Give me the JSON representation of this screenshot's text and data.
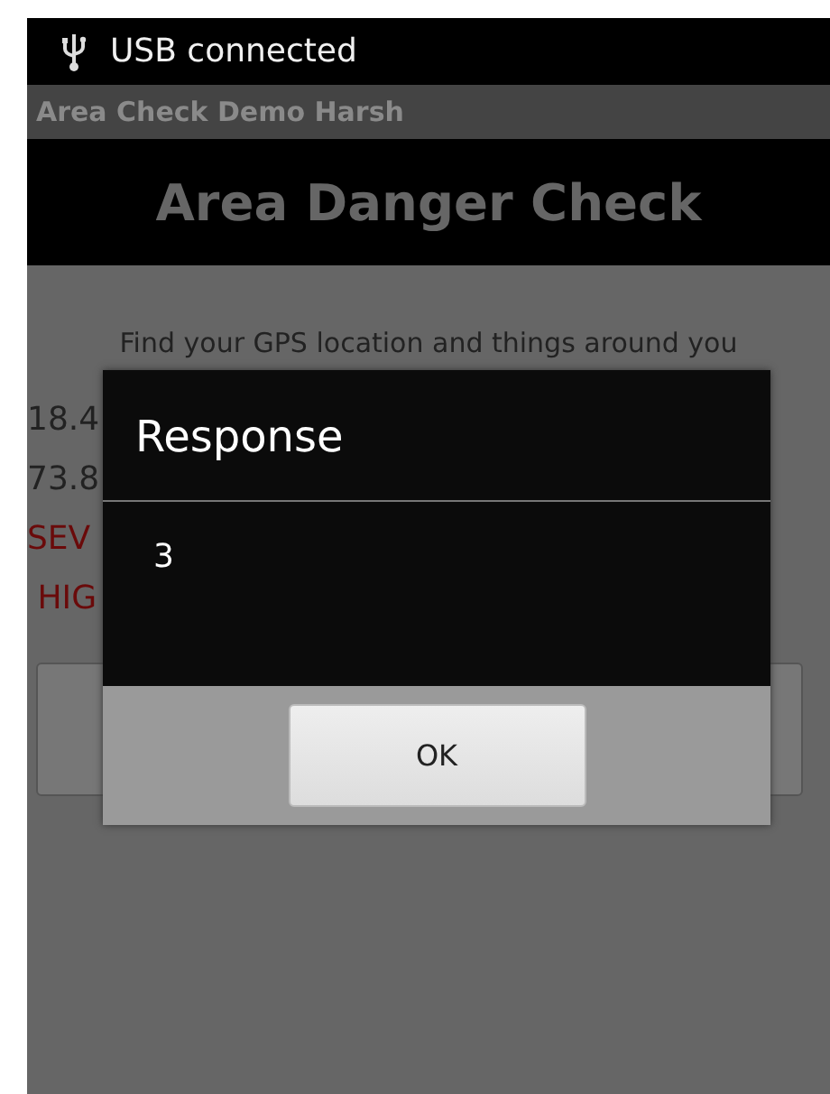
{
  "status_bar": {
    "text": "USB connected"
  },
  "app_bar": {
    "title": "Area Check Demo Harsh"
  },
  "header": {
    "title": "Area Danger Check"
  },
  "instruction": "Find your GPS location and things around you",
  "readings": [
    {
      "text": "18.4",
      "kind": "plain"
    },
    {
      "text": "73.8",
      "kind": "plain"
    },
    {
      "text": "SEV",
      "kind": "alert"
    },
    {
      "text": " HIG",
      "kind": "alert"
    }
  ],
  "dialog": {
    "title": "Response",
    "message": "3",
    "buttons": [
      "OK"
    ]
  }
}
